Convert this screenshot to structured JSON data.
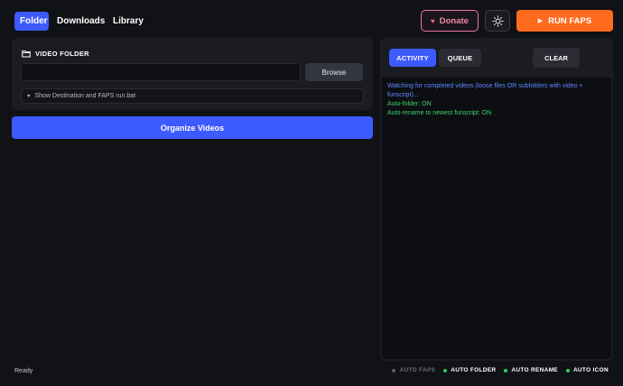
{
  "nav": {
    "tabs": [
      {
        "label": "Folder",
        "active": true
      },
      {
        "label": "Downloads",
        "active": false
      },
      {
        "label": "Library",
        "active": false
      }
    ]
  },
  "header": {
    "donate_label": "Donate",
    "donate_icon": "heart-icon",
    "theme_icon": "sun-icon",
    "run_label": "RUN FAPS",
    "run_icon": "play-icon"
  },
  "folder_panel": {
    "title": "VIDEO FOLDER",
    "title_icon": "folder-icon",
    "input_value": "",
    "browse_label": "Browse",
    "details_label": "Show Destination and FAPS run.bat"
  },
  "organize_label": "Organize Videos",
  "activity": {
    "tabs": [
      {
        "label": "ACTIVITY",
        "active": true
      },
      {
        "label": "QUEUE",
        "active": false
      }
    ],
    "clear_label": "CLEAR",
    "log": [
      {
        "text": "Watching for completed videos (loose files OR subfolders with video + funscript)...",
        "kind": "info"
      },
      {
        "text": "Auto-folder: ON",
        "kind": "ok"
      },
      {
        "text": "Auto-rename to newest funscript: ON",
        "kind": "ok"
      }
    ]
  },
  "status": {
    "text": "Ready",
    "indicators": [
      {
        "label": "AUTO FAPS",
        "on": false
      },
      {
        "label": "AUTO FOLDER",
        "on": true
      },
      {
        "label": "AUTO RENAME",
        "on": true
      },
      {
        "label": "AUTO ICON",
        "on": true
      }
    ]
  },
  "colors": {
    "accent": "#3d5afe",
    "run": "#ff6a1f",
    "donate": "#e8789c",
    "log_info": "#5b8cff",
    "log_ok": "#42d36a",
    "indicator_on": "#2ecc5a",
    "background": "#111216"
  }
}
